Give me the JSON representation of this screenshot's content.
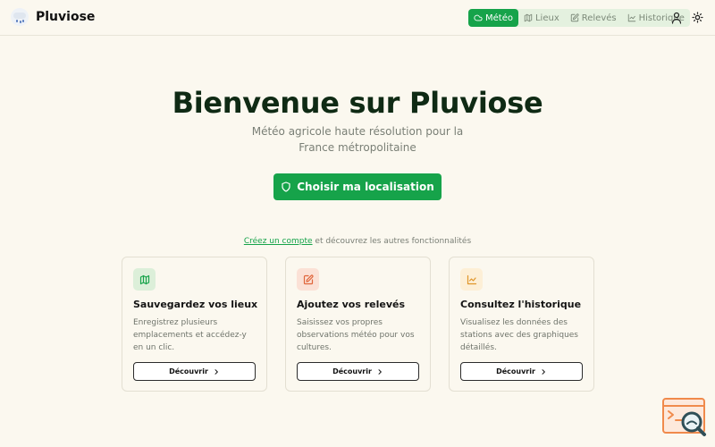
{
  "brand": {
    "name": "Pluviose"
  },
  "nav": {
    "items": [
      {
        "label": "Météo",
        "icon": "cloud-icon",
        "active": true
      },
      {
        "label": "Lieux",
        "icon": "map-icon",
        "active": false
      },
      {
        "label": "Relevés",
        "icon": "edit-icon",
        "active": false
      },
      {
        "label": "Historique",
        "icon": "chart-icon",
        "active": false
      }
    ],
    "user_icon": "user-icon",
    "theme_icon": "sun-icon"
  },
  "hero": {
    "title": "Bienvenue sur Pluviose",
    "subtitle_line1": "Météo agricole haute résolution pour la",
    "subtitle_line2": "France métropolitaine",
    "cta_label": "Choisir ma localisation",
    "cta_icon": "shield-icon"
  },
  "signup": {
    "link_text": "Créez un compte",
    "rest_text": " et découvrez les autres fonctionnalités"
  },
  "cards": [
    {
      "title": "Sauvegardez vos lieux",
      "desc_line1": "Enregistrez plusieurs",
      "desc_line2": "emplacements et accédez-y",
      "desc_line3": "en un clic.",
      "button_label": "Découvrir",
      "icon": "map-icon",
      "icon_bg": "#dcefd9",
      "icon_color": "#16a34a"
    },
    {
      "title": "Ajoutez vos relevés",
      "desc_line1": "Saisissez vos propres",
      "desc_line2": "observations météo pour vos",
      "desc_line3": "cultures.",
      "button_label": "Découvrir",
      "icon": "edit-icon",
      "icon_bg": "#fbe1d6",
      "icon_color": "#e0653a"
    },
    {
      "title": "Consultez l'historique",
      "desc_line1": "Visualisez les données des",
      "desc_line2": "stations avec des graphiques",
      "desc_line3": "détaillés.",
      "button_label": "Découvrir",
      "icon": "chart-icon",
      "icon_bg": "#fdefd6",
      "icon_color": "#e0962a"
    }
  ],
  "colors": {
    "accent": "#16a34a",
    "background": "#fbf8ef",
    "title": "#0f2a14"
  }
}
